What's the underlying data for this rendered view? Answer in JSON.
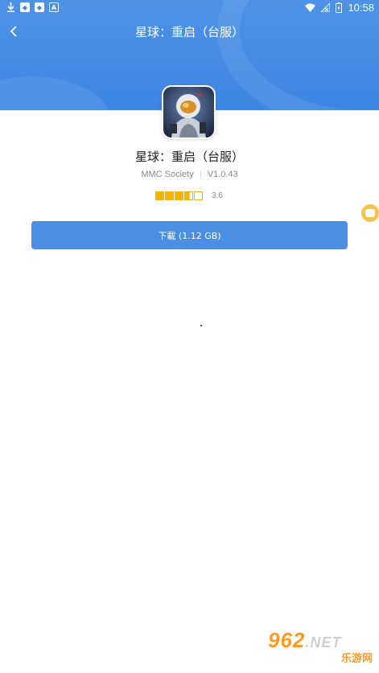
{
  "status_bar": {
    "time": "10:58",
    "left_icons": [
      "download-icon",
      "app-notification-icon",
      "app-notification-icon",
      "a-badge-icon"
    ],
    "right_icons": [
      "wifi-icon",
      "no-signal-icon",
      "battery-icon"
    ]
  },
  "nav": {
    "title": "星球：重启（台服）",
    "back_icon": "chevron-left-icon"
  },
  "app": {
    "name": "星球：重启（台服）",
    "developer": "MMC Society",
    "version": "V1.0.43",
    "rating": 3.6,
    "rating_text": "3.6",
    "stars_total": 5
  },
  "download": {
    "label": "下載 (1.12 GB)"
  },
  "watermark": {
    "top": "962",
    "net": ".NET",
    "bottom": "乐游网"
  },
  "colors": {
    "header": "#4389e4",
    "button": "#4a8fe3",
    "star": "#f2b705",
    "float_button": "#f6c34a"
  }
}
